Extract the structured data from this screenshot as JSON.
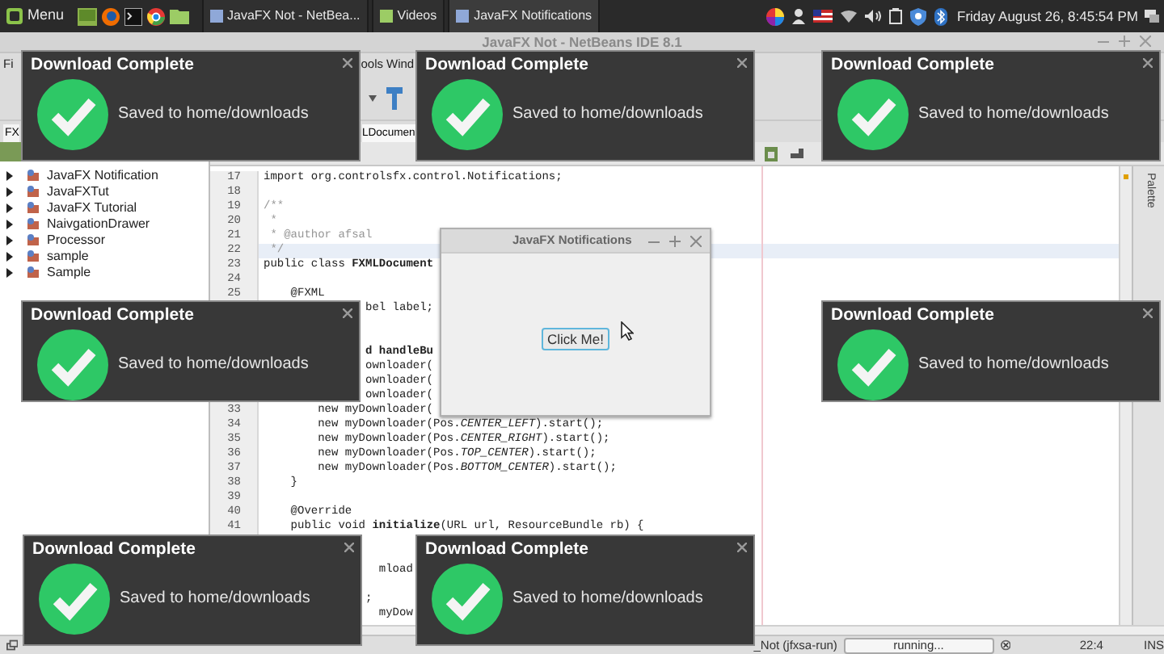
{
  "taskbar": {
    "menu_label": "Menu",
    "tasks": [
      {
        "label": "JavaFX Not - NetBea...",
        "selected": false
      },
      {
        "label": "Videos",
        "selected": false
      },
      {
        "label": "JavaFX Notifications",
        "selected": true
      }
    ],
    "clock": "Friday August 26, 8:45:54 PM"
  },
  "ide": {
    "title": "JavaFX Not - NetBeans IDE 8.1",
    "menu": [
      "Fi",
      "ools",
      "Wind"
    ],
    "project_tab": "FX",
    "editor_tab": "LDocumen",
    "projects": [
      "JavaFX Notification",
      "JavaFXTut",
      "JavaFX Tutorial",
      "NaivgationDrawer",
      "Processor",
      "sample",
      "Sample"
    ],
    "code_lines": [
      {
        "number": "17",
        "text": "import org.controlsfx.control.Notifications;",
        "kind": "code",
        "current": false
      },
      {
        "number": "18",
        "kind": "code",
        "current": false
      },
      {
        "number": "19",
        "text": "/**",
        "kind": "comment",
        "current": false
      },
      {
        "number": "20",
        "text": " *",
        "kind": "comment",
        "current": false
      },
      {
        "number": "21",
        "text": " * @author afsal",
        "kind": "comment",
        "current": false
      },
      {
        "number": "22",
        "text": " */",
        "kind": "comment",
        "current": true
      },
      {
        "number": "23",
        "text": "public class **FXMLDocument**",
        "kind": "code",
        "current": false
      },
      {
        "number": "24",
        "kind": "code",
        "current": false
      },
      {
        "number": "25",
        "text": "    @FXML",
        "kind": "code",
        "current": false
      },
      {
        "text": "               bel label;",
        "kind": "code",
        "current": false
      },
      {
        "kind": "code",
        "current": false
      },
      {
        "kind": "code",
        "current": false
      },
      {
        "text": "               **d handleBu**",
        "kind": "code",
        "current": false
      },
      {
        "text": "               ownloader(",
        "kind": "code",
        "current": false
      },
      {
        "text": "               ownloader(",
        "kind": "code",
        "current": false
      },
      {
        "text": "               ownloader(",
        "kind": "code",
        "current": false
      },
      {
        "number": "33",
        "text": "        new myDownloader(",
        "kind": "code",
        "current": false
      },
      {
        "number": "34",
        "text": "        new myDownloader(Pos.*CENTER_LEFT*).start();",
        "kind": "code",
        "current": false
      },
      {
        "number": "35",
        "text": "        new myDownloader(Pos.*CENTER_RIGHT*).start();",
        "kind": "code",
        "current": false
      },
      {
        "number": "36",
        "text": "        new myDownloader(Pos.*TOP_CENTER*).start();",
        "kind": "code",
        "current": false
      },
      {
        "number": "37",
        "text": "        new myDownloader(Pos.*BOTTOM_CENTER*).start();",
        "kind": "code",
        "current": false
      },
      {
        "number": "38",
        "text": "    }",
        "kind": "code",
        "current": false
      },
      {
        "number": "39",
        "kind": "code",
        "current": false
      },
      {
        "number": "40",
        "text": "    @Override",
        "kind": "code",
        "current": false
      },
      {
        "number": "41",
        "text": "    public void **initialize**(URL url, ResourceBundle rb) {",
        "kind": "code",
        "current": false
      },
      {
        "kind": "code",
        "current": false
      },
      {
        "kind": "code",
        "current": false
      },
      {
        "text": "                 mload",
        "kind": "code",
        "current": false
      },
      {
        "kind": "code",
        "current": false
      },
      {
        "text": "               ;",
        "kind": "code",
        "current": false
      },
      {
        "text": "                 myDow",
        "kind": "code",
        "current": false
      }
    ],
    "side_tab": "Palette",
    "status": {
      "task": "_Not (jfxsa-run)",
      "progress": "running...",
      "position": "22:4",
      "mode": "INS"
    }
  },
  "dialog": {
    "title": "JavaFX Notifications",
    "button": "Click Me!"
  },
  "notifications": [
    {
      "title": "Download Complete",
      "message": "Saved to home/downloads"
    },
    {
      "title": "Download Complete",
      "message": "Saved to home/downloads"
    },
    {
      "title": "Download Complete",
      "message": "Saved to home/downloads"
    },
    {
      "title": "Download Complete",
      "message": "Saved to home/downloads"
    },
    {
      "title": "Download Complete",
      "message": "Saved to home/downloads"
    },
    {
      "title": "Download Complete",
      "message": "Saved to home/downloads"
    },
    {
      "title": "Download Complete",
      "message": "Saved to home/downloads"
    }
  ]
}
